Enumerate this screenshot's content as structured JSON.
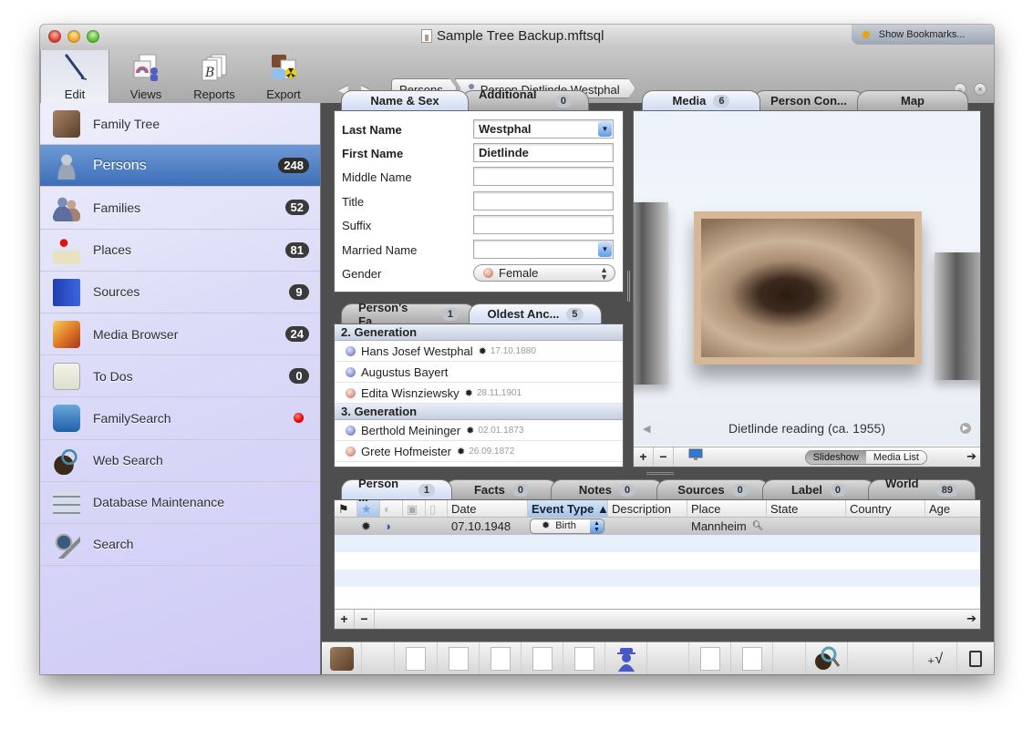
{
  "window": {
    "title": "Sample Tree Backup.mftsql",
    "bookmarks_label": "Show Bookmarks..."
  },
  "toolbar": {
    "items": [
      {
        "label": "Edit",
        "icon": "pen-icon",
        "active": true
      },
      {
        "label": "Views",
        "icon": "views-icon",
        "active": false
      },
      {
        "label": "Reports",
        "icon": "reports-icon",
        "active": false
      },
      {
        "label": "Export",
        "icon": "export-icon",
        "active": false
      }
    ]
  },
  "breadcrumb": {
    "items": [
      "Persons",
      "Person Dietlinde Westphal"
    ]
  },
  "sidebar": {
    "items": [
      {
        "label": "Family Tree",
        "icon": "family-tree-icon",
        "badge": null
      },
      {
        "label": "Persons",
        "icon": "person-icon",
        "badge": "248",
        "active": true
      },
      {
        "label": "Families",
        "icon": "families-icon",
        "badge": "52"
      },
      {
        "label": "Places",
        "icon": "map-pin-icon",
        "badge": "81"
      },
      {
        "label": "Sources",
        "icon": "book-icon",
        "badge": "9"
      },
      {
        "label": "Media Browser",
        "icon": "media-icon",
        "badge": "24"
      },
      {
        "label": "To Dos",
        "icon": "checklist-icon",
        "badge": "0"
      },
      {
        "label": "FamilySearch",
        "icon": "familysearch-icon",
        "badge": null,
        "status": "red-dot"
      },
      {
        "label": "Web Search",
        "icon": "globe-search-icon",
        "badge": null
      },
      {
        "label": "Database Maintenance",
        "icon": "database-icon",
        "badge": null
      },
      {
        "label": "Search",
        "icon": "magnifier-icon",
        "badge": null
      }
    ]
  },
  "name_panel": {
    "tabs": [
      {
        "label": "Name & Sex",
        "count": null,
        "active": true
      },
      {
        "label": "Additional ...",
        "count": "0",
        "active": false
      }
    ],
    "fields": [
      {
        "label": "Last Name",
        "value": "Westphal",
        "bold": true,
        "type": "combo"
      },
      {
        "label": "First Name",
        "value": "Dietlinde",
        "bold": true,
        "type": "text"
      },
      {
        "label": "Middle Name",
        "value": "",
        "type": "text"
      },
      {
        "label": "Title",
        "value": "",
        "type": "text"
      },
      {
        "label": "Suffix",
        "value": "",
        "type": "text"
      },
      {
        "label": "Married Name",
        "value": "",
        "type": "combo"
      },
      {
        "label": "Gender",
        "value": "Female",
        "type": "popup"
      }
    ]
  },
  "ancestors_panel": {
    "tabs": [
      {
        "label": "Person's Fa...",
        "count": "1",
        "active": false
      },
      {
        "label": "Oldest Anc...",
        "count": "5",
        "active": true
      }
    ],
    "groups": [
      {
        "heading": "2. Generation",
        "people": [
          {
            "name": "Hans Josef Westphal",
            "sex": "m",
            "birth": "17.10.1880"
          },
          {
            "name": "Augustus Bayert",
            "sex": "m",
            "birth": ""
          },
          {
            "name": "Edita Wisnziewsky",
            "sex": "f",
            "birth": "28.11.1901"
          }
        ]
      },
      {
        "heading": "3. Generation",
        "people": [
          {
            "name": "Berthold Meininger",
            "sex": "m",
            "birth": "02.01.1873"
          },
          {
            "name": "Grete Hofmeister",
            "sex": "f",
            "birth": "26.09.1872"
          }
        ]
      }
    ]
  },
  "media_panel": {
    "tabs": [
      {
        "label": "Media",
        "count": "6",
        "active": true
      },
      {
        "label": "Person Con...",
        "count": null,
        "active": false
      },
      {
        "label": "Map",
        "count": null,
        "active": false
      }
    ],
    "caption": "Dietlinde reading (ca. 1955)",
    "view_modes": [
      "Slideshow",
      "Media List"
    ],
    "active_view": "Slideshow"
  },
  "events_panel": {
    "tabs": [
      {
        "label": "Person ...",
        "count": "1",
        "active": true
      },
      {
        "label": "Facts",
        "count": "0"
      },
      {
        "label": "Notes",
        "count": "0"
      },
      {
        "label": "Sources",
        "count": "0"
      },
      {
        "label": "Label",
        "count": "0"
      },
      {
        "label": "World ...",
        "count": "89"
      }
    ],
    "columns": [
      "Date",
      "Event Type ▲",
      "Description",
      "Place",
      "State",
      "Country",
      "Age"
    ],
    "sorted_column": "Event Type",
    "rows": [
      {
        "date": "07.10.1948",
        "event_type": "Birth",
        "description": "",
        "place": "Mannheim",
        "state": "",
        "country": "",
        "age": ""
      }
    ]
  },
  "bottom_toolbar": {
    "icons": [
      "family-tree-icon",
      "ancestor-chart-icon",
      "descendant-chart-icon",
      "hourglass-chart-icon",
      "fan-chart-icon",
      "relationship-chart-icon",
      "agent-icon",
      "person-report-icon",
      "family-report-icon",
      "web-search-icon",
      "plausibility-icon",
      "window-icon"
    ]
  }
}
